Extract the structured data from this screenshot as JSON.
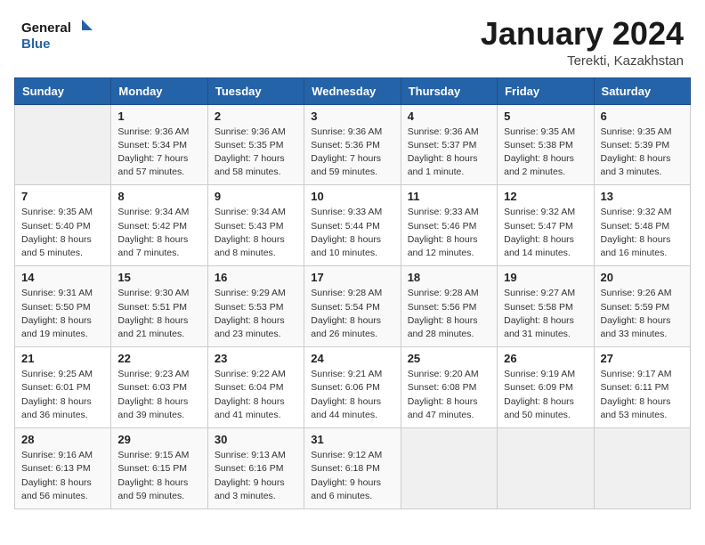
{
  "header": {
    "logo_general": "General",
    "logo_blue": "Blue",
    "month_title": "January 2024",
    "location": "Terekti, Kazakhstan"
  },
  "weekdays": [
    "Sunday",
    "Monday",
    "Tuesday",
    "Wednesday",
    "Thursday",
    "Friday",
    "Saturday"
  ],
  "weeks": [
    [
      {
        "day": "",
        "info": ""
      },
      {
        "day": "1",
        "info": "Sunrise: 9:36 AM\nSunset: 5:34 PM\nDaylight: 7 hours\nand 57 minutes."
      },
      {
        "day": "2",
        "info": "Sunrise: 9:36 AM\nSunset: 5:35 PM\nDaylight: 7 hours\nand 58 minutes."
      },
      {
        "day": "3",
        "info": "Sunrise: 9:36 AM\nSunset: 5:36 PM\nDaylight: 7 hours\nand 59 minutes."
      },
      {
        "day": "4",
        "info": "Sunrise: 9:36 AM\nSunset: 5:37 PM\nDaylight: 8 hours\nand 1 minute."
      },
      {
        "day": "5",
        "info": "Sunrise: 9:35 AM\nSunset: 5:38 PM\nDaylight: 8 hours\nand 2 minutes."
      },
      {
        "day": "6",
        "info": "Sunrise: 9:35 AM\nSunset: 5:39 PM\nDaylight: 8 hours\nand 3 minutes."
      }
    ],
    [
      {
        "day": "7",
        "info": "Sunrise: 9:35 AM\nSunset: 5:40 PM\nDaylight: 8 hours\nand 5 minutes."
      },
      {
        "day": "8",
        "info": "Sunrise: 9:34 AM\nSunset: 5:42 PM\nDaylight: 8 hours\nand 7 minutes."
      },
      {
        "day": "9",
        "info": "Sunrise: 9:34 AM\nSunset: 5:43 PM\nDaylight: 8 hours\nand 8 minutes."
      },
      {
        "day": "10",
        "info": "Sunrise: 9:33 AM\nSunset: 5:44 PM\nDaylight: 8 hours\nand 10 minutes."
      },
      {
        "day": "11",
        "info": "Sunrise: 9:33 AM\nSunset: 5:46 PM\nDaylight: 8 hours\nand 12 minutes."
      },
      {
        "day": "12",
        "info": "Sunrise: 9:32 AM\nSunset: 5:47 PM\nDaylight: 8 hours\nand 14 minutes."
      },
      {
        "day": "13",
        "info": "Sunrise: 9:32 AM\nSunset: 5:48 PM\nDaylight: 8 hours\nand 16 minutes."
      }
    ],
    [
      {
        "day": "14",
        "info": "Sunrise: 9:31 AM\nSunset: 5:50 PM\nDaylight: 8 hours\nand 19 minutes."
      },
      {
        "day": "15",
        "info": "Sunrise: 9:30 AM\nSunset: 5:51 PM\nDaylight: 8 hours\nand 21 minutes."
      },
      {
        "day": "16",
        "info": "Sunrise: 9:29 AM\nSunset: 5:53 PM\nDaylight: 8 hours\nand 23 minutes."
      },
      {
        "day": "17",
        "info": "Sunrise: 9:28 AM\nSunset: 5:54 PM\nDaylight: 8 hours\nand 26 minutes."
      },
      {
        "day": "18",
        "info": "Sunrise: 9:28 AM\nSunset: 5:56 PM\nDaylight: 8 hours\nand 28 minutes."
      },
      {
        "day": "19",
        "info": "Sunrise: 9:27 AM\nSunset: 5:58 PM\nDaylight: 8 hours\nand 31 minutes."
      },
      {
        "day": "20",
        "info": "Sunrise: 9:26 AM\nSunset: 5:59 PM\nDaylight: 8 hours\nand 33 minutes."
      }
    ],
    [
      {
        "day": "21",
        "info": "Sunrise: 9:25 AM\nSunset: 6:01 PM\nDaylight: 8 hours\nand 36 minutes."
      },
      {
        "day": "22",
        "info": "Sunrise: 9:23 AM\nSunset: 6:03 PM\nDaylight: 8 hours\nand 39 minutes."
      },
      {
        "day": "23",
        "info": "Sunrise: 9:22 AM\nSunset: 6:04 PM\nDaylight: 8 hours\nand 41 minutes."
      },
      {
        "day": "24",
        "info": "Sunrise: 9:21 AM\nSunset: 6:06 PM\nDaylight: 8 hours\nand 44 minutes."
      },
      {
        "day": "25",
        "info": "Sunrise: 9:20 AM\nSunset: 6:08 PM\nDaylight: 8 hours\nand 47 minutes."
      },
      {
        "day": "26",
        "info": "Sunrise: 9:19 AM\nSunset: 6:09 PM\nDaylight: 8 hours\nand 50 minutes."
      },
      {
        "day": "27",
        "info": "Sunrise: 9:17 AM\nSunset: 6:11 PM\nDaylight: 8 hours\nand 53 minutes."
      }
    ],
    [
      {
        "day": "28",
        "info": "Sunrise: 9:16 AM\nSunset: 6:13 PM\nDaylight: 8 hours\nand 56 minutes."
      },
      {
        "day": "29",
        "info": "Sunrise: 9:15 AM\nSunset: 6:15 PM\nDaylight: 8 hours\nand 59 minutes."
      },
      {
        "day": "30",
        "info": "Sunrise: 9:13 AM\nSunset: 6:16 PM\nDaylight: 9 hours\nand 3 minutes."
      },
      {
        "day": "31",
        "info": "Sunrise: 9:12 AM\nSunset: 6:18 PM\nDaylight: 9 hours\nand 6 minutes."
      },
      {
        "day": "",
        "info": ""
      },
      {
        "day": "",
        "info": ""
      },
      {
        "day": "",
        "info": ""
      }
    ]
  ]
}
